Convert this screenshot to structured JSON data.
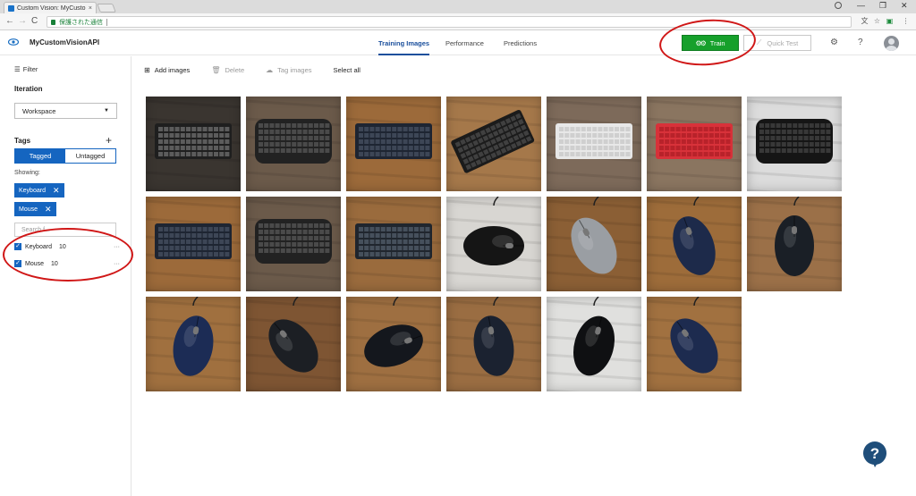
{
  "browser": {
    "tab_title": "Custom Vision: MyCusto",
    "tab_close": "×",
    "address_text": "保護された通信",
    "nav": {
      "back": "←",
      "forward": "→",
      "reload": "C"
    },
    "window": {
      "minimize": "—",
      "maximize": "❐",
      "close": "✕"
    }
  },
  "header": {
    "project_name": "MyCustomVisionAPI",
    "tabs": [
      "Training Images",
      "Performance",
      "Predictions"
    ],
    "train_label": "Train",
    "quicktest_label": "Quick Test",
    "settings_glyph": "⚙",
    "help_glyph": "?"
  },
  "sidebar": {
    "filter_label": "Filter",
    "iteration_heading": "Iteration",
    "iteration_value": "Workspace",
    "tags_heading": "Tags",
    "add_glyph": "+",
    "toggle": [
      "Tagged",
      "Untagged"
    ],
    "showing_label": "Showing:",
    "chips": [
      "Keyboard",
      "Mouse"
    ],
    "search_placeholder": "Search f...",
    "tag_list": [
      {
        "name": "Keyboard",
        "count": "10"
      },
      {
        "name": "Mouse",
        "count": "10"
      }
    ],
    "more_glyph": "···"
  },
  "toolbar": {
    "add_images": "Add images",
    "delete": "Delete",
    "tag_images": "Tag images",
    "select_all": "Select all"
  },
  "images": [
    {
      "kind": "laptop-keyboard"
    },
    {
      "kind": "ergonomic-keyboard"
    },
    {
      "kind": "keyboard-wood"
    },
    {
      "kind": "keyboard-angled"
    },
    {
      "kind": "white-keyboard"
    },
    {
      "kind": "red-keyboard"
    },
    {
      "kind": "keyboard-dark"
    },
    {
      "kind": "keyboard-wood"
    },
    {
      "kind": "ergonomic-keyboard"
    },
    {
      "kind": "keyboard-wood-2"
    },
    {
      "kind": "mouse-black-white"
    },
    {
      "kind": "mouse-silver"
    },
    {
      "kind": "mouse-blue"
    },
    {
      "kind": "mouse-hp"
    },
    {
      "kind": "mouse-blue-2"
    },
    {
      "kind": "mouse-side"
    },
    {
      "kind": "mouse-black"
    },
    {
      "kind": "mouse-hp-2"
    },
    {
      "kind": "mouse-dark-grey"
    },
    {
      "kind": "mouse-blue-3"
    }
  ],
  "colors": {
    "accent": "#1565c0",
    "train_green": "#16a02b",
    "annotation_red": "#d01717"
  }
}
